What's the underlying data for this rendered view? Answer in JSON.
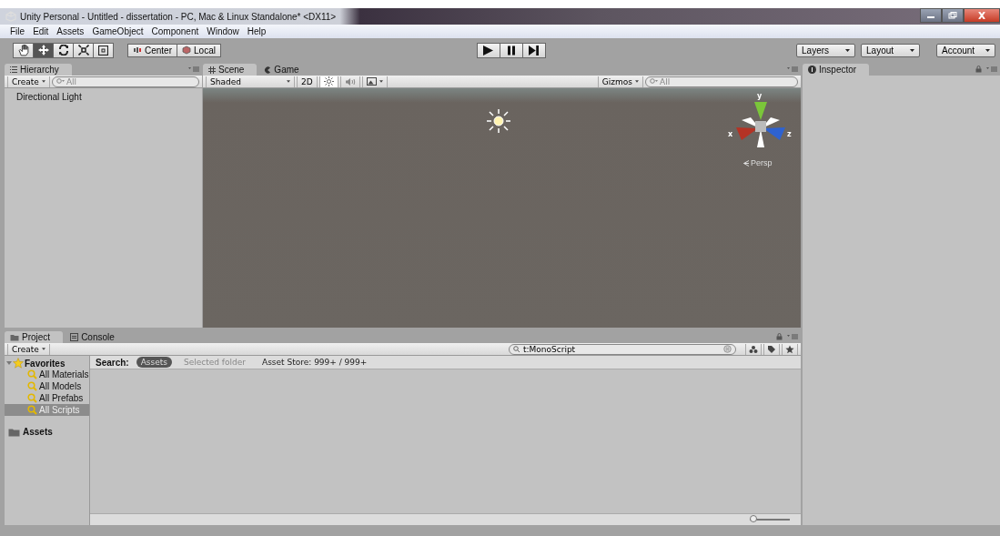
{
  "window": {
    "title": "Unity Personal - Untitled - dissertation - PC, Mac & Linux Standalone* <DX11>"
  },
  "menu": [
    "File",
    "Edit",
    "Assets",
    "GameObject",
    "Component",
    "Window",
    "Help"
  ],
  "tools": [
    {
      "kind": "hand",
      "selected": false
    },
    {
      "kind": "move",
      "selected": true
    },
    {
      "kind": "rotate",
      "selected": false
    },
    {
      "kind": "scale",
      "selected": false
    },
    {
      "kind": "rect",
      "selected": false
    }
  ],
  "pivot_buttons": [
    {
      "kind": "pivot",
      "label": "Center"
    },
    {
      "kind": "space",
      "label": "Local"
    }
  ],
  "playback": [
    {
      "kind": "play"
    },
    {
      "kind": "pause"
    },
    {
      "kind": "step"
    }
  ],
  "dropdowns": [
    "Layers",
    "Layout",
    "Account"
  ],
  "hierarchy": {
    "tab": "Hierarchy",
    "create": "Create",
    "search_placeholder": "All",
    "items": [
      "Directional Light"
    ]
  },
  "scene": {
    "tabs": [
      {
        "label": "Scene",
        "kind": "scene",
        "selected": true
      },
      {
        "label": "Game",
        "kind": "game",
        "selected": false
      }
    ],
    "shading": "Shaded",
    "mode_2d": "2D",
    "lighting": true,
    "audio": false,
    "gizmos": "Gizmos",
    "search_placeholder": "All",
    "axes": {
      "y": "y",
      "x": "x",
      "z": "z"
    },
    "projection": "Persp"
  },
  "inspector": {
    "tab": "Inspector"
  },
  "project": {
    "tabs": [
      {
        "label": "Project",
        "kind": "project",
        "selected": true
      },
      {
        "label": "Console",
        "kind": "console",
        "selected": false
      }
    ],
    "create": "Create",
    "search_value": "t:MonoScript",
    "favorites": {
      "label": "Favorites",
      "expanded": true,
      "children": [
        {
          "label": "All Materials",
          "selected": false
        },
        {
          "label": "All Models",
          "selected": false
        },
        {
          "label": "All Prefabs",
          "selected": false
        },
        {
          "label": "All Scripts",
          "selected": true
        }
      ]
    },
    "folders": [
      "Assets"
    ],
    "search_label": "Search:",
    "scopes": [
      {
        "label": "Assets",
        "selected": true
      },
      {
        "label": "Selected folder",
        "selected": false
      }
    ],
    "asset_store": "Asset Store: 999+ / 999+",
    "zoom": {
      "level": 0
    }
  }
}
